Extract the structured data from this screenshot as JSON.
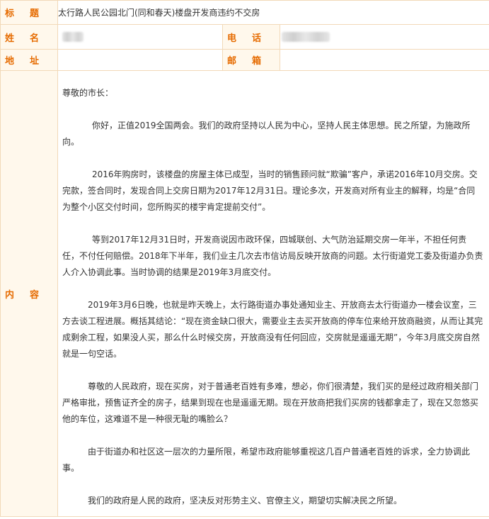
{
  "form": {
    "title_label": [
      "标",
      "题"
    ],
    "title_value": "太行路人民公园北门(同和春天)楼盘开发商违约不交房",
    "name_label": [
      "姓",
      "名"
    ],
    "phone_label": [
      "电",
      "话"
    ],
    "address_label": [
      "地",
      "址"
    ],
    "email_label": [
      "邮",
      "箱"
    ],
    "content_label": [
      "内",
      "容"
    ]
  },
  "content": {
    "greeting": "尊敬的市长：",
    "paragraphs": [
      "你好，正值2019全国两会。我们的政府坚持以人民为中心，坚持人民主体思想。民之所望，为施政所向。",
      "2016年购房时，该楼盘的房屋主体已成型，当时的销售顾问就“欺骗”客户，承诺2016年10月交房。交完款，签合同时，发现合同上交房日期为2017年12月31日。理论多次，开发商对所有业主的解释，均是“合同为整个小区交付时间，您所购买的楼宇肯定提前交付”。",
      "等到2017年12月31日时，开发商说因市政环保，四城联创、大气防治延期交房一年半，不担任何责任，不付任何赔偿。2018年下半年，我们业主几次去市信访局反映开放商的问题。太行街道党工委及街道办负责人介入协调此事。当时协调的结果是2019年3月底交付。",
      "2019年3月6日晚，也就是昨天晚上，太行路街道办事处通知业主、开放商去太行街道办一楼会议室，三方去谈工程进展。概括其结论：“现在资金缺口很大，需要业主去买开放商的停车位来给开放商融资，从而让其完成剩余工程，如果没人买，那么什么时候交房，开放商没有任何回应，交房就是遥遥无期”，今年3月底交房自然就是一句空话。",
      "尊敬的人民政府，现在买房，对于普通老百姓有多难，想必，你们很清楚，我们买的是经过政府相关部门严格审批，预售证齐全的房子，结果到现在也是遥遥无期。现在开放商把我们买房的钱都拿走了，现在又忽悠买他的车位，这难道不是一种很无耻的嘴脸么？",
      "由于街道办和社区这一层次的力量所限，希望市政府能够重视这几百户普通老百姓的诉求，全力协调此事。",
      "我们的政府是人民的政府，坚决反对形势主义、官僚主义，期望切实解决民之所望。"
    ]
  }
}
